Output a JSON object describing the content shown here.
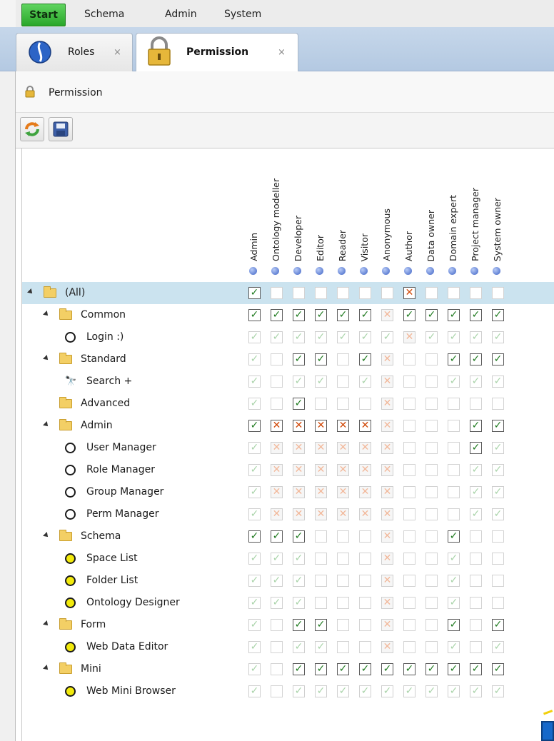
{
  "menubar": {
    "start": "Start",
    "items": [
      "Schema",
      "Admin",
      "System"
    ]
  },
  "tabs": [
    {
      "label": "Roles",
      "close": "×",
      "icon": "roles-icon"
    },
    {
      "label": "Permission",
      "close": "×",
      "icon": "lock-icon",
      "active": true
    }
  ],
  "breadcrumb": {
    "label": "Permission",
    "icon": "lock-icon"
  },
  "toolbar": [
    {
      "name": "refresh-button",
      "icon": "refresh-icon"
    },
    {
      "name": "save-button",
      "icon": "save-icon"
    }
  ],
  "columns": [
    "Admin",
    "Ontology modeller",
    "Developer",
    "Editor",
    "Reader",
    "Visitor",
    "Anonymous",
    "Author",
    "Data owner",
    "Domain expert",
    "Project manager",
    "System owner"
  ],
  "legend": {
    "C": "checked",
    "X": "denied",
    "c": "inherited-checked",
    "x": "inherited-denied",
    "0": "empty",
    "o": "faint-empty"
  },
  "rows": [
    {
      "label": "(All)",
      "level": 0,
      "icon": "folder-icon",
      "expander": true,
      "selected": true,
      "perms": "C000000X0000"
    },
    {
      "label": "Common",
      "level": 1,
      "icon": "folder-icon",
      "expander": true,
      "perms": "CCCCCCxCCCCC"
    },
    {
      "label": "Login :)",
      "level": 2,
      "icon": "circle-icon",
      "perms": "cccccccxcccc"
    },
    {
      "label": "Standard",
      "level": 1,
      "icon": "folder-icon",
      "expander": true,
      "perms": "c0CC0Cx00CCC"
    },
    {
      "label": "Search +",
      "level": 2,
      "icon": "binoculars-icon",
      "perms": "c0cc0cx00ccc"
    },
    {
      "label": "Advanced",
      "level": 1,
      "icon": "folder-icon",
      "perms": "c0C000x00000"
    },
    {
      "label": "Admin",
      "level": 1,
      "icon": "folder-icon",
      "expander": true,
      "perms": "CXXXXXx000CC"
    },
    {
      "label": "User Manager",
      "level": 2,
      "icon": "circle-icon",
      "perms": "cxxxxxx000Cc"
    },
    {
      "label": "Role Manager",
      "level": 2,
      "icon": "circle-icon",
      "perms": "cxxxxxx000cc"
    },
    {
      "label": "Group Manager",
      "level": 2,
      "icon": "circle-icon",
      "perms": "cxxxxxx000cc"
    },
    {
      "label": "Perm Manager",
      "level": 2,
      "icon": "circle-icon",
      "perms": "cxxxxxx000cc"
    },
    {
      "label": "Schema",
      "level": 1,
      "icon": "folder-icon",
      "expander": true,
      "perms": "CCC000x00C00"
    },
    {
      "label": "Space List",
      "level": 2,
      "icon": "circle-yellow-icon",
      "perms": "ccc000x00c00"
    },
    {
      "label": "Folder List",
      "level": 2,
      "icon": "circle-yellow-icon",
      "perms": "ccc000x00c00"
    },
    {
      "label": "Ontology Designer",
      "level": 2,
      "icon": "circle-yellow-icon",
      "perms": "ccc000x00c00"
    },
    {
      "label": "Form",
      "level": 1,
      "icon": "folder-icon",
      "expander": true,
      "perms": "c0CC00x00C0C"
    },
    {
      "label": "Web Data Editor",
      "level": 2,
      "icon": "circle-yellow-icon",
      "perms": "c0cc00x00c0c"
    },
    {
      "label": "Mini",
      "level": 1,
      "icon": "folder-icon",
      "expander": true,
      "perms": "c0CCCCCCCCCC"
    },
    {
      "label": "Web Mini Browser",
      "level": 2,
      "icon": "circle-yellow-icon",
      "perms": "c0cccccccccc"
    }
  ]
}
